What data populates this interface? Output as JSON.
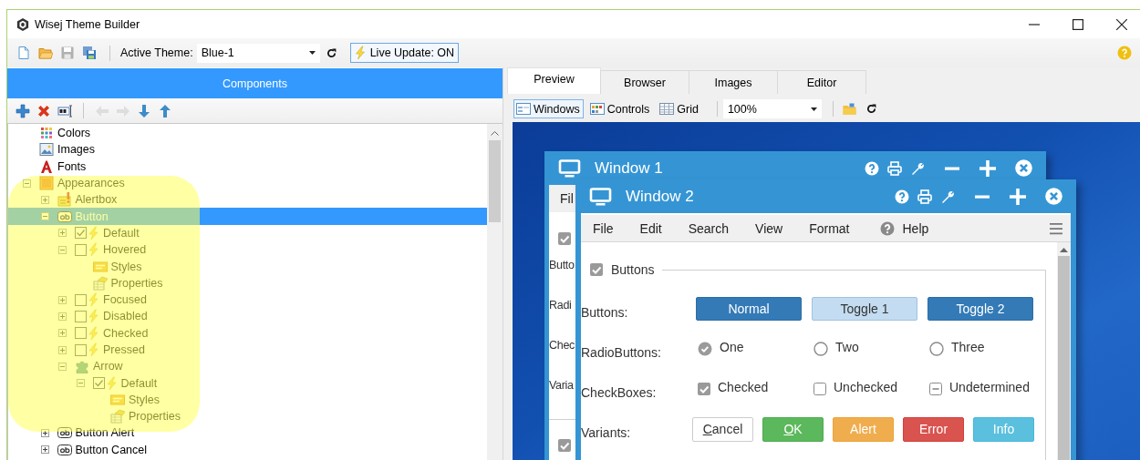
{
  "window": {
    "title": "Wisej Theme Builder"
  },
  "toolbar": {
    "buttons": [
      {
        "kind": "new",
        "disabled": false
      },
      {
        "kind": "open",
        "disabled": false
      },
      {
        "kind": "save",
        "disabled": true
      },
      {
        "kind": "save_all",
        "disabled": false
      }
    ],
    "theme_label": "Active Theme:",
    "theme": "Blue-1",
    "live_update": {
      "label": "Live Update: ON",
      "on": true
    }
  },
  "components": {
    "title": "Components",
    "tools": [
      {
        "kind": "add",
        "disabled": false
      },
      {
        "kind": "delete",
        "disabled": false
      },
      {
        "kind": "rename",
        "disabled": false
      },
      {
        "kind": "left",
        "disabled": true
      },
      {
        "kind": "right",
        "disabled": true
      },
      {
        "kind": "down",
        "disabled": false
      },
      {
        "kind": "up",
        "disabled": false
      }
    ],
    "tree": [
      {
        "label": "Colors",
        "kind": "colors",
        "selected": false
      },
      {
        "label": "Images",
        "kind": "images",
        "selected": false
      },
      {
        "label": "Fonts",
        "kind": "fonts",
        "selected": false
      },
      {
        "label": "Appearances",
        "kind": "appearances",
        "expanded": true,
        "selected": false,
        "children": [
          {
            "label": "Alertbox",
            "kind": "alertbox",
            "expanded": false,
            "selected": false
          },
          {
            "label": "Button",
            "kind": "button",
            "expanded": true,
            "selected": true,
            "children": [
              {
                "label": "Default",
                "kind": "state",
                "checked": true,
                "expanded": false,
                "selected": false
              },
              {
                "label": "Hovered",
                "kind": "state",
                "checked": false,
                "expanded": true,
                "selected": false,
                "children": [
                  {
                    "label": "Styles",
                    "kind": "styles",
                    "selected": false
                  },
                  {
                    "label": "Properties",
                    "kind": "properties",
                    "selected": false
                  }
                ]
              },
              {
                "label": "Focused",
                "kind": "state",
                "checked": false,
                "expanded": false,
                "selected": false
              },
              {
                "label": "Disabled",
                "kind": "state",
                "checked": false,
                "expanded": false,
                "selected": false
              },
              {
                "label": "Checked",
                "kind": "state",
                "checked": false,
                "expanded": false,
                "selected": false
              },
              {
                "label": "Pressed",
                "kind": "state",
                "checked": false,
                "expanded": false,
                "selected": false
              },
              {
                "label": "Arrow",
                "kind": "arrow",
                "expanded": true,
                "selected": false,
                "children": [
                  {
                    "label": "Default",
                    "kind": "state",
                    "checked": true,
                    "expanded": true,
                    "selected": false,
                    "children": [
                      {
                        "label": "Styles",
                        "kind": "styles",
                        "selected": false
                      },
                      {
                        "label": "Properties",
                        "kind": "properties",
                        "selected": false
                      }
                    ]
                  }
                ]
              }
            ]
          },
          {
            "label": "Button Alert",
            "kind": "button",
            "expanded": false,
            "selected": false
          },
          {
            "label": "Button Cancel",
            "kind": "button",
            "expanded": false,
            "selected": false
          }
        ]
      }
    ]
  },
  "tabs": [
    {
      "label": "Preview",
      "selected": true
    },
    {
      "label": "Browser",
      "selected": false
    },
    {
      "label": "Images",
      "selected": false
    },
    {
      "label": "Editor",
      "selected": false
    }
  ],
  "preview_toolbar": {
    "views": [
      {
        "kind": "windows",
        "label": "Windows",
        "selected": true
      },
      {
        "kind": "controls",
        "label": "Controls",
        "selected": false
      },
      {
        "kind": "grid",
        "label": "Grid",
        "selected": false
      }
    ],
    "zoom": "100%"
  },
  "window_1": {
    "title": "Window 1",
    "menu": [
      "Fil"
    ],
    "group_checked": true,
    "labels": [
      "Butto",
      "Radi",
      "Chec",
      "Varia"
    ],
    "next_group_checked": true
  },
  "window_2": {
    "title": "Window 2",
    "menu": [
      {
        "label": "File",
        "kind": "text"
      },
      {
        "label": "Edit",
        "kind": "text"
      },
      {
        "label": "Search",
        "kind": "text"
      },
      {
        "label": "View",
        "kind": "text"
      },
      {
        "label": "Format",
        "kind": "text"
      },
      {
        "label": "Help",
        "kind": "help"
      }
    ],
    "group": {
      "title": "Buttons",
      "checked": true,
      "rows": [
        {
          "label": "Buttons:",
          "kind": "buttons",
          "items": [
            {
              "label": "Normal",
              "pressed": false
            },
            {
              "label": "Toggle 1",
              "pressed": true
            },
            {
              "label": "Toggle 2",
              "pressed": false
            }
          ]
        },
        {
          "label": "RadioButtons:",
          "kind": "radios",
          "items": [
            {
              "label": "One",
              "selected": true
            },
            {
              "label": "Two",
              "selected": false
            },
            {
              "label": "Three",
              "selected": false
            }
          ]
        },
        {
          "label": "CheckBoxes:",
          "kind": "checkboxes",
          "items": [
            {
              "label": "Checked",
              "checked": true,
              "indeterminate": false
            },
            {
              "label": "Unchecked",
              "checked": false,
              "indeterminate": false
            },
            {
              "label": "Undetermined",
              "checked": false,
              "indeterminate": true
            }
          ]
        },
        {
          "label": "Variants:",
          "kind": "variants",
          "items": [
            {
              "label": "Cancel",
              "kind": "default",
              "mnemonic": true
            },
            {
              "label": "OK",
              "kind": "success",
              "mnemonic": true
            },
            {
              "label": "Alert",
              "kind": "warning",
              "mnemonic": false
            },
            {
              "label": "Error",
              "kind": "danger",
              "mnemonic": false
            },
            {
              "label": "Info",
              "kind": "info",
              "mnemonic": false
            }
          ]
        }
      ]
    }
  }
}
